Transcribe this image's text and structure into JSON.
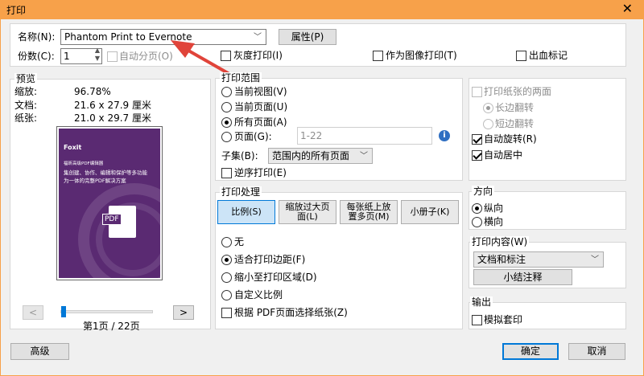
{
  "window": {
    "title": "打印",
    "close_glyph": "✕"
  },
  "printer": {
    "name_label": "名称(N):",
    "name_value": "Phantom Print to Evernote",
    "properties_label": "属性(P)",
    "copies_label": "份数(C):",
    "copies_value": "1",
    "collate_label": "自动分页(O)",
    "grayscale_label": "灰度打印(I)",
    "print_as_image_label": "作为图像打印(T)",
    "bleed_marks_label": "出血标记"
  },
  "preview": {
    "legend": "预览",
    "zoom_label": "缩放:",
    "zoom_value": "96.78%",
    "document_label": "文档:",
    "document_value": "21.6 x 27.9 厘米",
    "paper_label": "纸张:",
    "paper_value": "21.0 x 29.7 厘米",
    "thumb": {
      "brand": "Foxit",
      "heading": "福昕高级PDF编辑器",
      "line1": "集创建、协作、编辑和保护等多功能",
      "line2": "为一体的完整PDF解决方案",
      "pdf_badge": "PDF"
    },
    "prev_label": "<",
    "next_label": ">",
    "page_indicator": "第1页 / 22页",
    "slider_fraction": 0.0
  },
  "range": {
    "legend": "打印范围",
    "current_view": "当前视图(V)",
    "current_page": "当前页面(U)",
    "all_pages": "所有页面(A)",
    "pages": "页面(G):",
    "pages_placeholder": "1-22",
    "subset_label": "子集(B):",
    "subset_value": "范围内的所有页面",
    "reverse": "逆序打印(E)"
  },
  "handling": {
    "legend": "打印处理",
    "tabs": [
      "比例(S)",
      "缩放过大页面(L)",
      "每张纸上放置多页(M)",
      "小册子(K)"
    ],
    "none": "无",
    "fit_margins": "适合打印边距(F)",
    "shrink": "缩小至打印区域(D)",
    "custom": "自定义比例",
    "by_pdf_size": "根据 PDF页面选择纸张(Z)"
  },
  "duplex": {
    "both_sides": "打印纸张的两面",
    "long_edge": "长边翻转",
    "short_edge": "短边翻转",
    "auto_rotate": "自动旋转(R)",
    "auto_center": "自动居中"
  },
  "orientation": {
    "legend": "方向",
    "portrait": "纵向",
    "landscape": "横向"
  },
  "content": {
    "legend": "打印内容(W)",
    "value": "文档和标注",
    "summarize": "小结注释"
  },
  "output": {
    "legend": "输出",
    "simulate_overprint": "模拟套印"
  },
  "footer": {
    "advanced": "高级",
    "ok": "确定",
    "cancel": "取消"
  },
  "colors": {
    "titlebar": "#f7a14a",
    "thumb_bg": "#5a2a72",
    "accent": "#0078d7",
    "annotation_arrow": "#e0443a"
  }
}
